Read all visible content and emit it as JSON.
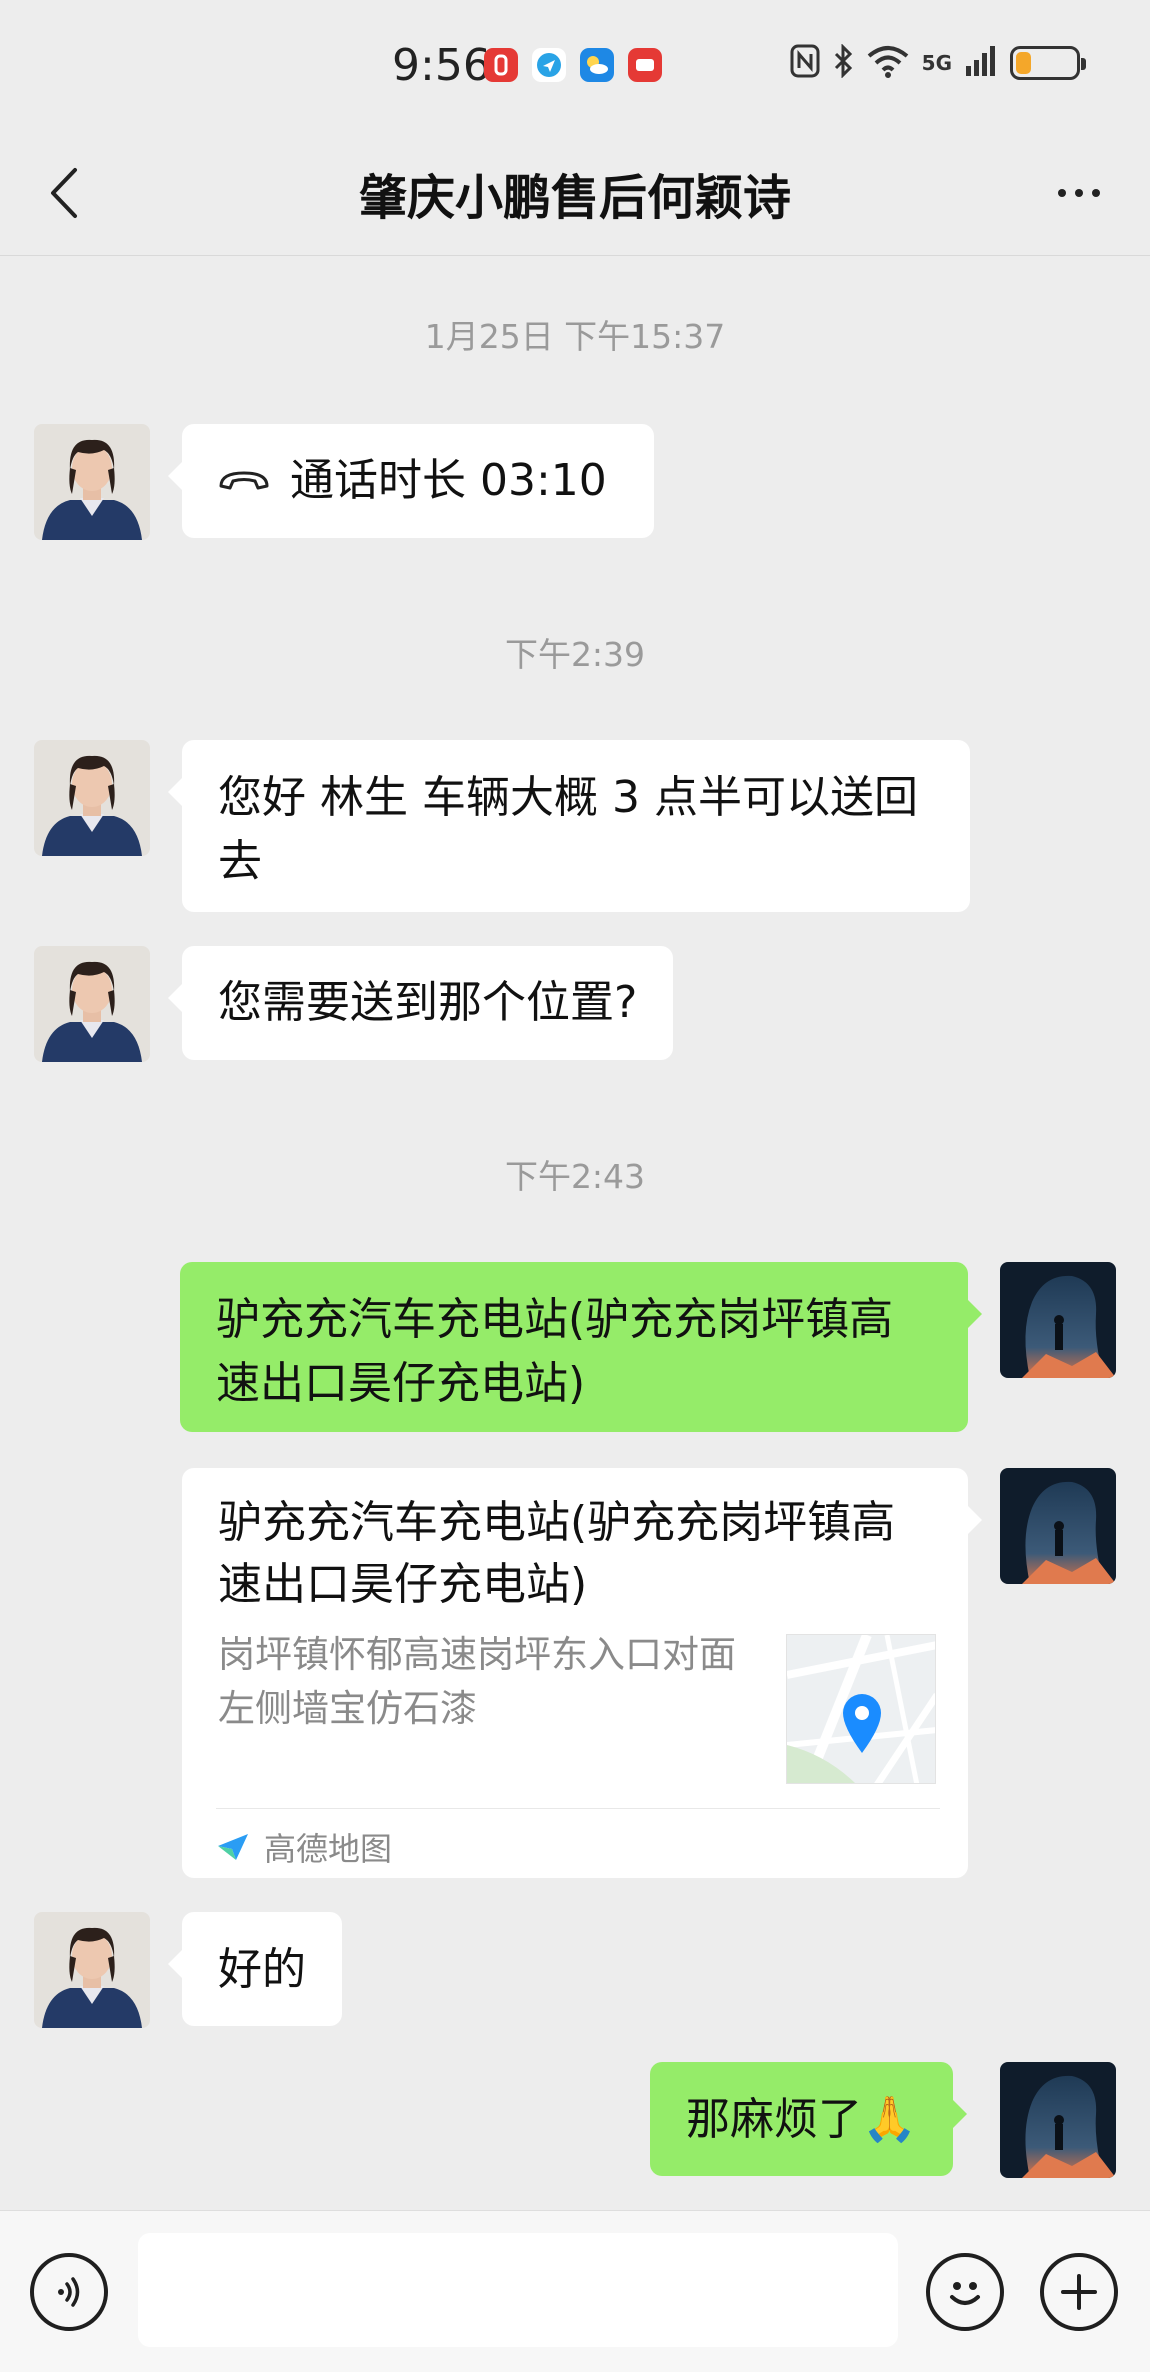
{
  "status_bar": {
    "time": "9:56",
    "network": "5G",
    "battery_level": 0.25,
    "icons": [
      "nfc-icon",
      "bluetooth-icon",
      "wifi-icon",
      "signal-icon",
      "battery-icon"
    ],
    "app_icons": [
      "notification-red-icon",
      "notification-blue-icon",
      "weather-icon",
      "video-red-icon"
    ]
  },
  "header": {
    "title": "肇庆小鹏售后何颖诗",
    "back_icon": "chevron-left-icon",
    "more_icon": "more-icon"
  },
  "messages": {
    "ts1": "1月25日 下午15:37",
    "call_text": "通话时长 03:10",
    "ts2": "下午2:39",
    "msg1": "您好  林生  车辆大概 3 点半可以送回去",
    "msg2": "您需要送到那个位置?",
    "ts3": "下午2:43",
    "msg3": "驴充充汽车充电站(驴充充岗坪镇高速出口昊仔充电站)",
    "location": {
      "title": "驴充充汽车充电站(驴充充岗坪镇高速出口昊仔充电站)",
      "address": "岗坪镇怀郁高速岗坪东入口对面左侧墙宝仿石漆",
      "source": "高德地图"
    },
    "msg4": "好的",
    "msg5": "那麻烦了🙏"
  },
  "input_bar": {
    "placeholder": "",
    "voice_icon": "voice-icon",
    "emoji_icon": "emoji-icon",
    "plus_icon": "plus-icon"
  },
  "colors": {
    "background": "#ededed",
    "sent_bubble": "#95ec69",
    "received_bubble": "#ffffff",
    "timestamp_text": "#9a9a9a",
    "map_pin": "#1a8cff"
  }
}
